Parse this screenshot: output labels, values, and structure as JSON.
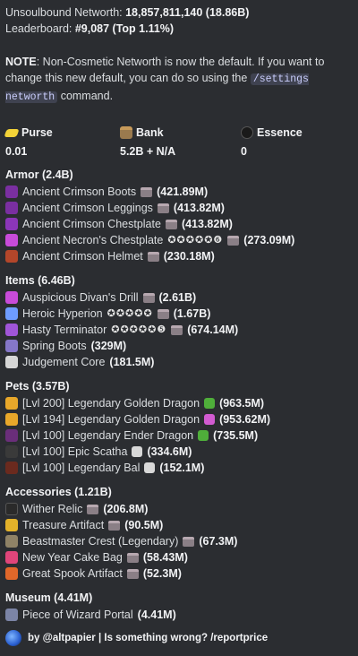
{
  "header": {
    "networth_label": "Unsoulbound Networth: ",
    "networth_value": "18,857,811,140 (18.86B)",
    "leaderboard_label": "Leaderboard: ",
    "leaderboard_value": "#9,087 (Top 1.11%)"
  },
  "note": {
    "bold": "NOTE",
    "text1": ": Non-Cosmetic Networth is now the default. If you want to change this new default, you can do so using the ",
    "command": "/settings networth",
    "text2": " command."
  },
  "stats": [
    {
      "label": "Purse",
      "value": "0.01",
      "icon": "gold-ingot-icon",
      "color": "#f3d338"
    },
    {
      "label": "Bank",
      "value": "5.2B + N/A",
      "icon": "chest-icon",
      "color": "#9a7a4e"
    },
    {
      "label": "Essence",
      "value": "0",
      "icon": "wither-essence-icon",
      "color": "#1a1a1a"
    }
  ],
  "sections": {
    "armor": {
      "title": "Armor (2.4B)",
      "items": [
        {
          "name": "Ancient Crimson Boots",
          "stars": "",
          "price": "(421.89M)",
          "icon": "crimson-boots-icon",
          "color": "#7a2fa1"
        },
        {
          "name": "Ancient Crimson Leggings",
          "stars": "",
          "price": "(413.82M)",
          "icon": "crimson-leggings-icon",
          "color": "#7a2fa1"
        },
        {
          "name": "Ancient Crimson Chestplate",
          "stars": "",
          "price": "(413.82M)",
          "icon": "crimson-chestplate-icon",
          "color": "#8b36b8"
        },
        {
          "name": "Ancient Necron's Chestplate",
          "stars": "✪✪✪✪✪❻",
          "price": "(273.09M)",
          "icon": "necron-chestplate-icon",
          "color": "#c84bd9"
        },
        {
          "name": "Ancient Crimson Helmet",
          "stars": "",
          "price": "(230.18M)",
          "icon": "crimson-helmet-icon",
          "color": "#b3462a"
        }
      ]
    },
    "items": {
      "title": "Items (6.46B)",
      "items": [
        {
          "name": "Auspicious Divan's Drill",
          "stars": "",
          "price": "(2.61B)",
          "icon": "drill-icon",
          "color": "#c84bd9"
        },
        {
          "name": "Heroic Hyperion",
          "stars": "✪✪✪✪✪",
          "price": "(1.67B)",
          "icon": "hyperion-sword-icon",
          "color": "#6e9cff"
        },
        {
          "name": "Hasty Terminator",
          "stars": "✪✪✪✪✪❺",
          "price": "(674.14M)",
          "icon": "terminator-bow-icon",
          "color": "#a055d8"
        },
        {
          "name": "Spring Boots",
          "stars": "",
          "price": "(329M)",
          "icon": "spring-boots-icon",
          "color": "#8577c8",
          "no_chest": true
        },
        {
          "name": "Judgement Core",
          "stars": "",
          "price": "(181.5M)",
          "icon": "judgement-core-icon",
          "color": "#d6d6d6",
          "no_chest": true
        }
      ]
    },
    "pets": {
      "title": "Pets (3.57B)",
      "items": [
        {
          "name": "[Lvl 200] Legendary Golden Dragon",
          "stars": "",
          "price": "(963.5M)",
          "icon": "golden-dragon-icon",
          "color": "#e8a72a",
          "item_icon": "green-gem-icon",
          "item_color": "#4fae3a"
        },
        {
          "name": "[Lvl 194] Legendary Golden Dragon",
          "stars": "",
          "price": "(953.62M)",
          "icon": "golden-dragon-icon",
          "color": "#e8a72a",
          "item_icon": "crossed-swords-icon",
          "item_color": "#d25bd1"
        },
        {
          "name": "[Lvl 100] Legendary Ender Dragon",
          "stars": "",
          "price": "(735.5M)",
          "icon": "ender-dragon-icon",
          "color": "#6a2e7a",
          "item_icon": "green-gem-icon",
          "item_color": "#4fae3a"
        },
        {
          "name": "[Lvl 100] Epic Scatha",
          "stars": "",
          "price": "(334.6M)",
          "icon": "scatha-icon",
          "color": "#3a3a3a",
          "item_icon": "white-cube-icon",
          "item_color": "#d8d8d8"
        },
        {
          "name": "[Lvl 100] Legendary Bal",
          "stars": "",
          "price": "(152.1M)",
          "icon": "bal-icon",
          "color": "#6b2a1e",
          "item_icon": "white-cube-icon",
          "item_color": "#d8d8d8"
        }
      ]
    },
    "accessories": {
      "title": "Accessories (1.21B)",
      "items": [
        {
          "name": "Wither Relic",
          "stars": "",
          "price": "(206.8M)",
          "icon": "wither-relic-icon",
          "color": "#2a2a2a"
        },
        {
          "name": "Treasure Artifact",
          "stars": "",
          "price": "(90.5M)",
          "icon": "treasure-artifact-icon",
          "color": "#e3b22a"
        },
        {
          "name": "Beastmaster Crest (Legendary)",
          "stars": "",
          "price": "(67.3M)",
          "icon": "beastmaster-crest-icon",
          "color": "#8f8266"
        },
        {
          "name": "New Year Cake Bag",
          "stars": "",
          "price": "(58.43M)",
          "icon": "cake-bag-icon",
          "color": "#e0457a"
        },
        {
          "name": "Great Spook Artifact",
          "stars": "",
          "price": "(52.3M)",
          "icon": "spook-artifact-icon",
          "color": "#e0672a"
        }
      ]
    },
    "museum": {
      "title": "Museum (4.41M)",
      "items": [
        {
          "name": "Piece of Wizard Portal",
          "stars": "",
          "price": "(4.41M)",
          "icon": "wizard-portal-icon",
          "color": "#7b84a6",
          "no_chest": true
        }
      ]
    }
  },
  "footer": {
    "text": "by @altpapier | Is something wrong? /reportprice"
  }
}
